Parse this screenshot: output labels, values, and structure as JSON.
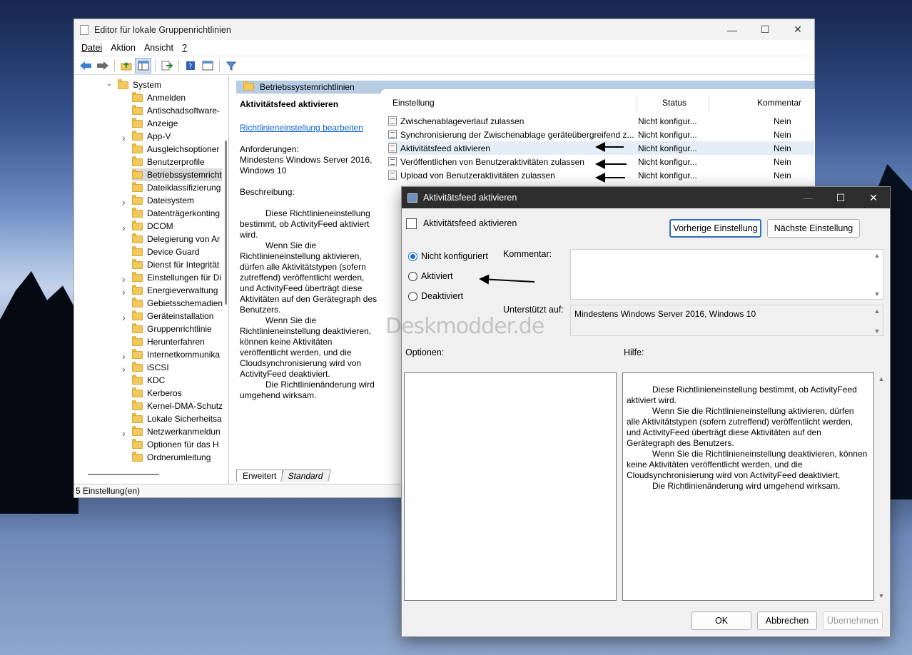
{
  "main_window": {
    "title": "Editor für lokale Gruppenrichtlinien",
    "menu": [
      "Datei",
      "Aktion",
      "Ansicht",
      "?"
    ],
    "tree": {
      "root": "System",
      "items": [
        {
          "label": "Anmelden",
          "expandable": false
        },
        {
          "label": "Antischadsoftware-",
          "expandable": false
        },
        {
          "label": "Anzeige",
          "expandable": false
        },
        {
          "label": "App-V",
          "expandable": true
        },
        {
          "label": "Ausgleichsoptioner",
          "expandable": false
        },
        {
          "label": "Benutzerprofile",
          "expandable": false
        },
        {
          "label": "Betriebssystemricht",
          "expandable": false,
          "selected": true
        },
        {
          "label": "Dateiklassifizierung",
          "expandable": false
        },
        {
          "label": "Dateisystem",
          "expandable": true
        },
        {
          "label": "Datenträgerkonting",
          "expandable": false
        },
        {
          "label": "DCOM",
          "expandable": true
        },
        {
          "label": "Delegierung von Ar",
          "expandable": false
        },
        {
          "label": "Device Guard",
          "expandable": false
        },
        {
          "label": "Dienst für Integrität",
          "expandable": false
        },
        {
          "label": "Einstellungen für Di",
          "expandable": true
        },
        {
          "label": "Energieverwaltung",
          "expandable": true
        },
        {
          "label": "Gebietsschemadien",
          "expandable": false
        },
        {
          "label": "Geräteinstallation",
          "expandable": true
        },
        {
          "label": "Gruppenrichtlinie",
          "expandable": false
        },
        {
          "label": "Herunterfahren",
          "expandable": false
        },
        {
          "label": "Internetkommunika",
          "expandable": true
        },
        {
          "label": "iSCSI",
          "expandable": true
        },
        {
          "label": "KDC",
          "expandable": false
        },
        {
          "label": "Kerberos",
          "expandable": false
        },
        {
          "label": "Kernel-DMA-Schutz",
          "expandable": false
        },
        {
          "label": "Lokale Sicherheitsa",
          "expandable": false
        },
        {
          "label": "Netzwerkanmeldun",
          "expandable": true
        },
        {
          "label": "Optionen für das H",
          "expandable": false
        },
        {
          "label": "Ordnerumleitung",
          "expandable": false
        }
      ]
    },
    "folder_header": "Betriebssystemrichtlinien",
    "description": {
      "title": "Aktivitätsfeed aktivieren",
      "edit_link": "Richtlinieneinstellung bearbeiten",
      "requirements_label": "Anforderungen:",
      "requirements": "Mindestens Windows Server 2016, Windows 10",
      "description_label": "Beschreibung:",
      "para1": "Diese Richtlinieneinstellung bestimmt, ob ActivityFeed aktiviert wird.",
      "para2": "Wenn Sie die Richtlinieneinstellung aktivieren, dürfen alle Aktivitätstypen (sofern zutreffend) veröffentlicht werden, und ActivityFeed überträgt diese Aktivitäten auf den Gerätegraph des Benutzers.",
      "para3": "Wenn Sie die Richtlinieneinstellung deaktivieren, können keine Aktivitäten veröffentlicht werden, und die Cloudsynchronisierung wird von ActivityFeed deaktiviert.",
      "para4": "Die Richtlinienänderung wird umgehend wirksam."
    },
    "columns": {
      "setting": "Einstellung",
      "status": "Status",
      "comment": "Kommentar"
    },
    "settings": [
      {
        "name": "Zwischenablageverlauf zulassen",
        "status": "Nicht konfigur...",
        "comment": "Nein"
      },
      {
        "name": "Synchronisierung der Zwischenablage geräteübergreifend z...",
        "status": "Nicht konfigur...",
        "comment": "Nein"
      },
      {
        "name": "Aktivitätsfeed aktivieren",
        "status": "Nicht konfigur...",
        "comment": "Nein"
      },
      {
        "name": "Veröffentlichen von Benutzeraktivitäten zulassen",
        "status": "Nicht konfigur...",
        "comment": "Nein"
      },
      {
        "name": "Upload von Benutzeraktivitäten zulassen",
        "status": "Nicht konfigur...",
        "comment": "Nein"
      }
    ],
    "tabs": [
      "Erweitert",
      "Standard"
    ],
    "status_bar": "5 Einstellung(en)"
  },
  "dialog": {
    "title": "Aktivitätsfeed aktivieren",
    "setting_name": "Aktivitätsfeed aktivieren",
    "prev_button": "Vorherige Einstellung",
    "next_button": "Nächste Einstellung",
    "radios": [
      "Nicht konfiguriert",
      "Aktiviert",
      "Deaktiviert"
    ],
    "selected_radio": "Nicht konfiguriert",
    "comment_label": "Kommentar:",
    "supported_label": "Unterstützt auf:",
    "supported_value": "Mindestens Windows Server 2016, Windows 10",
    "options_label": "Optionen:",
    "help_label": "Hilfe:",
    "help": {
      "para1": "Diese Richtlinieneinstellung bestimmt, ob ActivityFeed aktiviert wird.",
      "para2": "Wenn Sie die Richtlinieneinstellung aktivieren, dürfen alle Aktivitätstypen (sofern zutreffend) veröffentlicht werden, und ActivityFeed überträgt diese Aktivitäten auf den Gerätegraph des Benutzers.",
      "para3": "Wenn Sie die Richtlinieneinstellung deaktivieren, können keine Aktivitäten veröffentlicht werden, und die Cloudsynchronisierung wird von ActivityFeed deaktiviert.",
      "para4": "Die Richtlinienänderung wird umgehend wirksam."
    },
    "ok": "OK",
    "cancel": "Abbrechen",
    "apply": "Übernehmen"
  },
  "watermark": "Deskmodder.de",
  "colors": {
    "accent": "#1a6ed8",
    "header_band": "#b7cde3",
    "dialog_titlebar": "#2d2d2d",
    "folder": "#f2c95e"
  }
}
